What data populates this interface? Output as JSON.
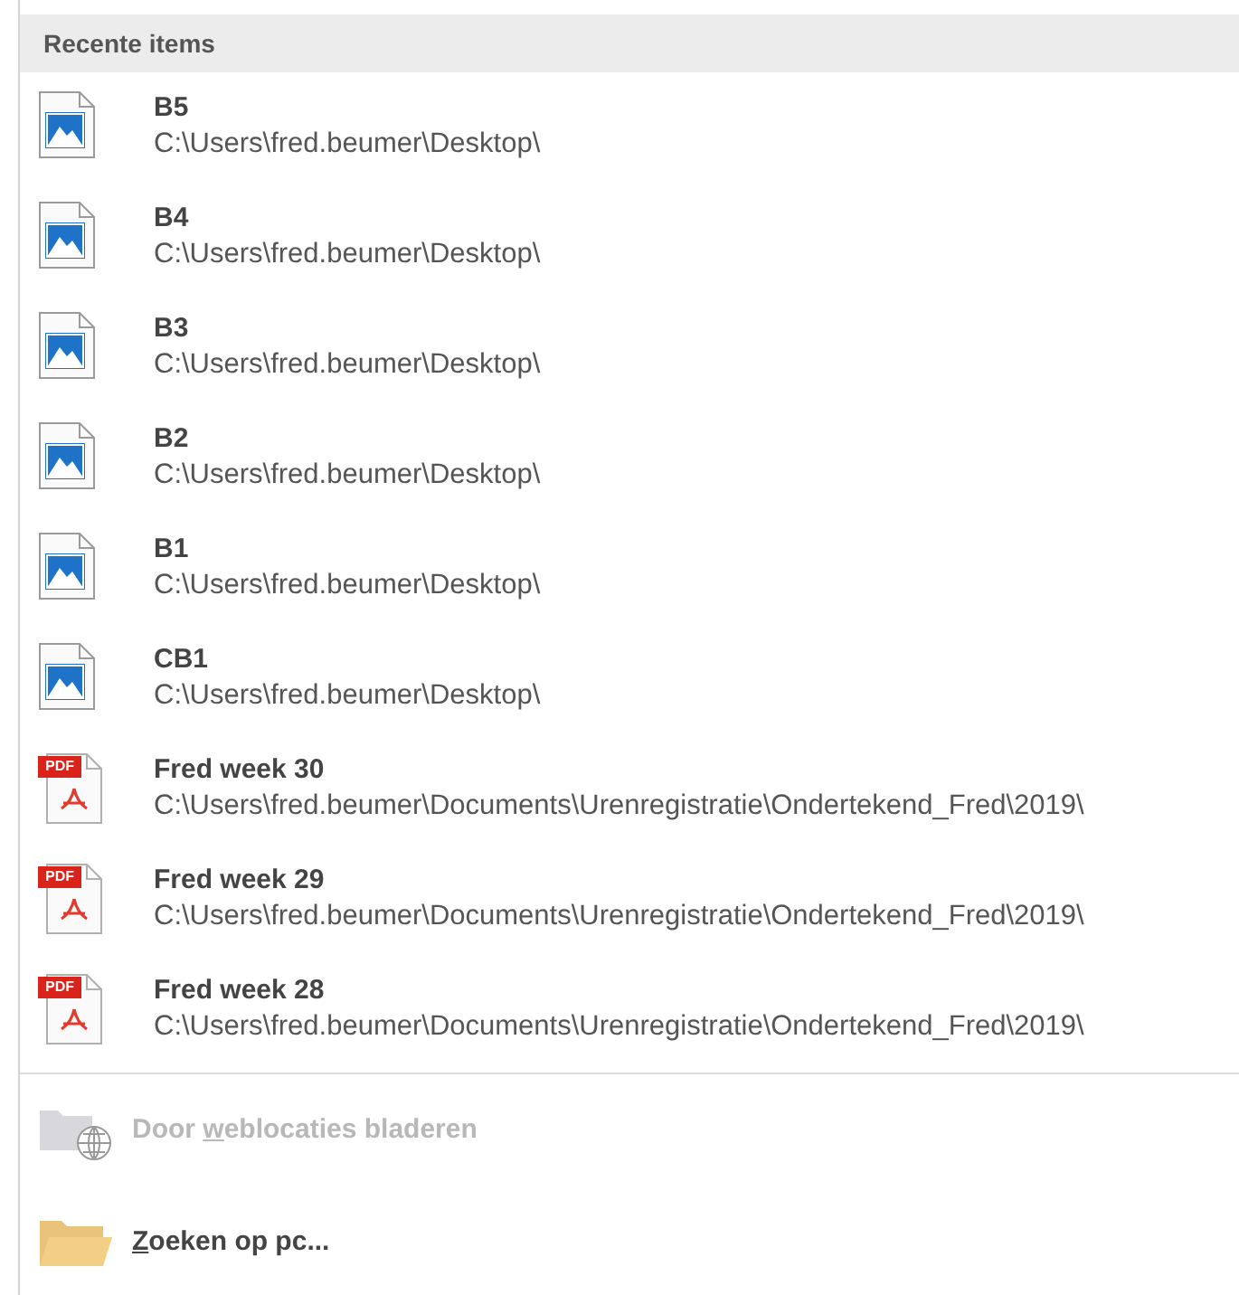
{
  "section": {
    "title": "Recente items"
  },
  "items": [
    {
      "kind": "image",
      "name": "B5",
      "path": "C:\\Users\\fred.beumer\\Desktop\\"
    },
    {
      "kind": "image",
      "name": "B4",
      "path": "C:\\Users\\fred.beumer\\Desktop\\"
    },
    {
      "kind": "image",
      "name": "B3",
      "path": "C:\\Users\\fred.beumer\\Desktop\\"
    },
    {
      "kind": "image",
      "name": "B2",
      "path": "C:\\Users\\fred.beumer\\Desktop\\"
    },
    {
      "kind": "image",
      "name": "B1",
      "path": "C:\\Users\\fred.beumer\\Desktop\\"
    },
    {
      "kind": "image",
      "name": "CB1",
      "path": "C:\\Users\\fred.beumer\\Desktop\\"
    },
    {
      "kind": "pdf",
      "icon_text": "PDF",
      "name": "Fred week 30",
      "path": "C:\\Users\\fred.beumer\\Documents\\Urenregistratie\\Ondertekend_Fred\\2019\\"
    },
    {
      "kind": "pdf",
      "icon_text": "PDF",
      "name": "Fred week 29",
      "path": "C:\\Users\\fred.beumer\\Documents\\Urenregistratie\\Ondertekend_Fred\\2019\\"
    },
    {
      "kind": "pdf",
      "icon_text": "PDF",
      "name": "Fred week 28",
      "path": "C:\\Users\\fred.beumer\\Documents\\Urenregistratie\\Ondertekend_Fred\\2019\\"
    }
  ],
  "actions": [
    {
      "kind": "web",
      "before": "Door ",
      "access_key": "w",
      "after": "eblocaties bladeren",
      "disabled": true
    },
    {
      "kind": "folder",
      "access_key": "Z",
      "after": "oeken op pc...",
      "disabled": false
    }
  ]
}
